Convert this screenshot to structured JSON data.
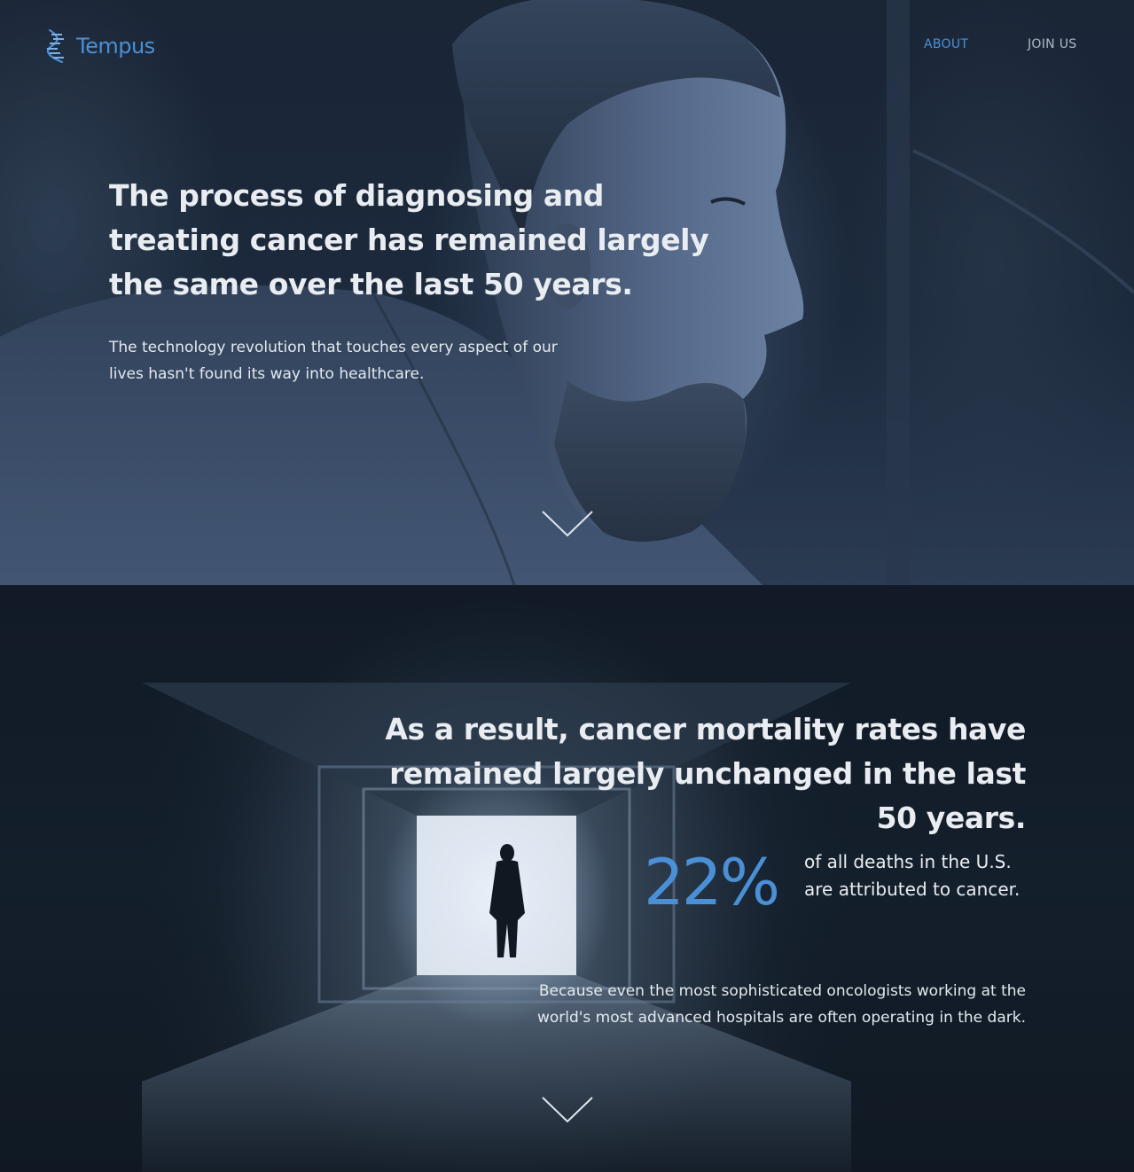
{
  "brand": {
    "name": "Tempus",
    "accent_color": "#4a90d6",
    "logo_icon": "dna-helix-icon"
  },
  "nav": {
    "items": [
      {
        "label": "ABOUT",
        "active": true
      },
      {
        "label": "JOIN US",
        "active": false
      }
    ]
  },
  "hero": {
    "title": "The process of diagnosing and treating cancer has remained largely the same over the last 50 years.",
    "subtitle": "The technology revolution that touches every aspect of our lives hasn't found its way into healthcare.",
    "background_image": "man-profile-photo",
    "scroll_icon": "chevron-down-icon"
  },
  "mortality": {
    "title": "As a result, cancer mortality rates have remained largely unchanged in the last 50 years.",
    "stat_value": "22%",
    "stat_text": "of all deaths in the U.S. are attributed to cancer.",
    "body": "Because even the most sophisticated oncologists working at the world's most advanced hospitals are often operating in the dark.",
    "background_image": "tunnel-silhouette-photo",
    "scroll_icon": "chevron-down-icon"
  }
}
